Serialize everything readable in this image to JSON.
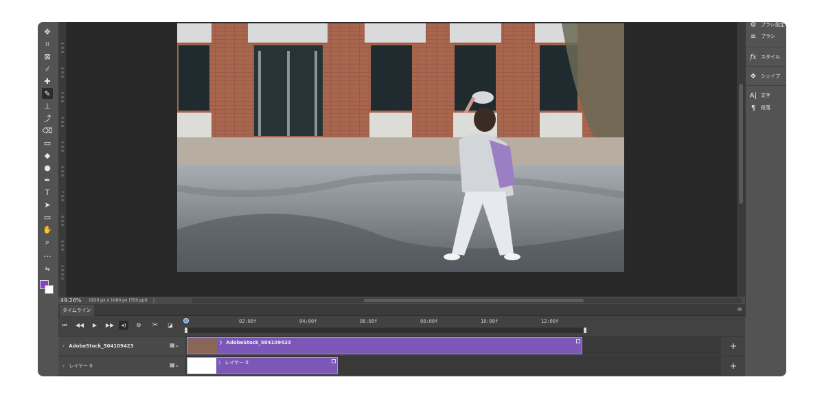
{
  "toolbar": {
    "tools": [
      {
        "name": "move-tool",
        "glyph": "✥"
      },
      {
        "name": "crop-tool",
        "glyph": "⌗"
      },
      {
        "name": "frame-tool",
        "glyph": "⊠"
      },
      {
        "name": "eyedropper-tool",
        "glyph": "⌿"
      },
      {
        "name": "spot-healing-tool",
        "glyph": "✚"
      },
      {
        "name": "brush-tool",
        "glyph": "✎"
      },
      {
        "name": "clone-stamp-tool",
        "glyph": "⊥"
      },
      {
        "name": "history-brush-tool",
        "glyph": "⤴"
      },
      {
        "name": "eraser-tool",
        "glyph": "⌫"
      },
      {
        "name": "gradient-tool",
        "glyph": "▭"
      },
      {
        "name": "blur-tool",
        "glyph": "◆"
      },
      {
        "name": "dodge-tool",
        "glyph": "●"
      },
      {
        "name": "pen-tool",
        "glyph": "✒"
      },
      {
        "name": "type-tool",
        "glyph": "T"
      },
      {
        "name": "path-selection-tool",
        "glyph": "➤"
      },
      {
        "name": "rectangle-tool",
        "glyph": "▭"
      },
      {
        "name": "hand-tool",
        "glyph": "✋"
      },
      {
        "name": "zoom-tool",
        "glyph": "⌕"
      },
      {
        "name": "more-tools",
        "glyph": "…"
      }
    ],
    "foreground_color": "#8b3fc1",
    "background_color": "#ffffff"
  },
  "ruler": {
    "vertical_labels": [
      "1 0 0",
      "2 0 0",
      "3 0 0",
      "4 0 0",
      "5 0 0",
      "6 0 0",
      "7 0 0",
      "8 0 0",
      "9 0 0",
      "1 0 0 0"
    ]
  },
  "right_panels": {
    "items": [
      {
        "icon": "brush-settings-icon",
        "glyph": "⚙",
        "label": "ブラシ設定"
      },
      {
        "icon": "brush-icon",
        "glyph": "≡",
        "label": "ブラシ"
      },
      {
        "icon": "styles-icon",
        "glyph": "fx",
        "label": "スタイル"
      },
      {
        "icon": "shapes-icon",
        "glyph": "✥",
        "label": "シェイプ"
      },
      {
        "icon": "character-icon",
        "glyph": "A|",
        "label": "文字"
      },
      {
        "icon": "paragraph-icon",
        "glyph": "¶",
        "label": "段落"
      }
    ]
  },
  "status": {
    "zoom": "49.26%",
    "document_info": "1920 px x 1080 px (350 ppi)",
    "arrow": "〉"
  },
  "timeline": {
    "tab_label": "タイムライン",
    "menu_glyph": "≡",
    "time_labels": [
      "02:00f",
      "04:00f",
      "06:00f",
      "08:00f",
      "10:00f",
      "12:00f"
    ],
    "tracks": [
      {
        "name": "AdobeStock_504109423",
        "clip_label": "〉 AdobeStock_504109423",
        "duration_seconds": 13.1
      },
      {
        "name": "レイヤー 0",
        "clip_label": "〉 レイヤー 0",
        "duration_seconds": 5.0
      }
    ],
    "add_glyph": "+",
    "colors": {
      "clip": "#7d57b8",
      "playhead": "#6a9bd8"
    }
  }
}
